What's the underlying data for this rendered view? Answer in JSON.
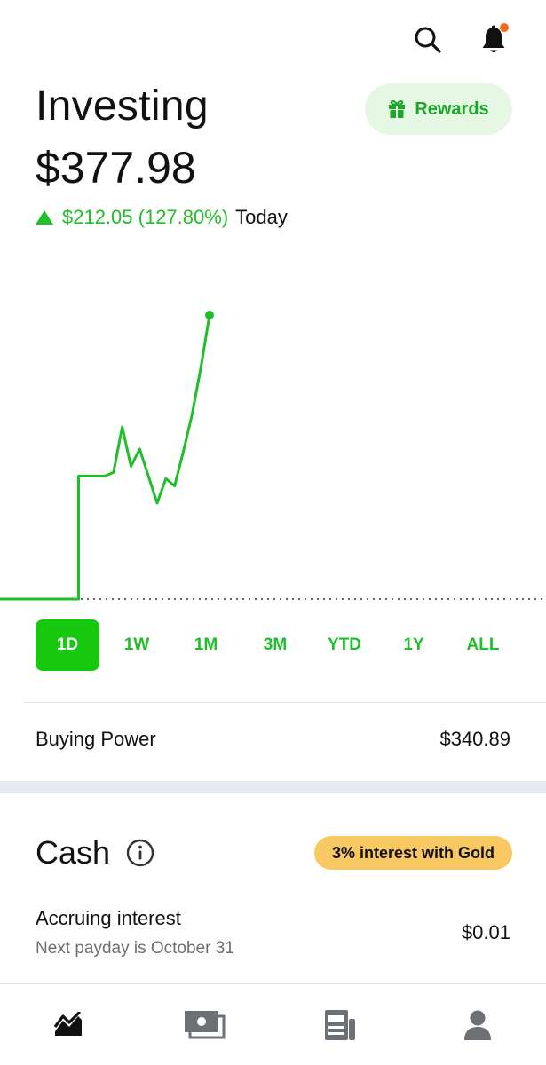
{
  "header": {
    "title": "Investing",
    "balance": "$377.98",
    "change": "$212.05 (127.80%)",
    "change_period": "Today",
    "rewards_label": "Rewards",
    "icons": [
      "search-icon",
      "bell-icon",
      "gift-icon"
    ]
  },
  "chart_data": {
    "type": "line",
    "x": [
      0,
      1,
      2,
      3,
      4,
      5,
      6,
      7,
      8,
      9,
      10,
      11,
      12,
      13,
      14,
      15,
      16,
      17,
      18,
      19,
      20,
      21,
      22,
      23,
      24
    ],
    "values": [
      0,
      0,
      0,
      0,
      0,
      0,
      0,
      0,
      0,
      1.0,
      1.0,
      1.0,
      1.0,
      1.03,
      1.4,
      1.08,
      1.22,
      1.0,
      0.78,
      0.98,
      0.92,
      1.2,
      1.5,
      1.88,
      2.31
    ],
    "baseline": 0,
    "grid": false,
    "color": "#1fbf2b"
  },
  "ranges": [
    "1D",
    "1W",
    "1M",
    "3M",
    "YTD",
    "1Y",
    "ALL"
  ],
  "active_range": "1D",
  "buying_power": {
    "label": "Buying Power",
    "value": "$340.89"
  },
  "cash": {
    "title": "Cash",
    "badge": "3% interest with Gold",
    "accruing_label": "Accruing interest",
    "payday": "Next payday is October 31",
    "accruing_value": "$0.01"
  },
  "tabs": [
    "investing-tab",
    "cash-tab",
    "news-tab",
    "account-tab"
  ],
  "colors": {
    "accent": "#1fbf2b",
    "accent_bg": "#e6f7e3",
    "gold": "#f8c862",
    "notification": "#f26a1b"
  }
}
